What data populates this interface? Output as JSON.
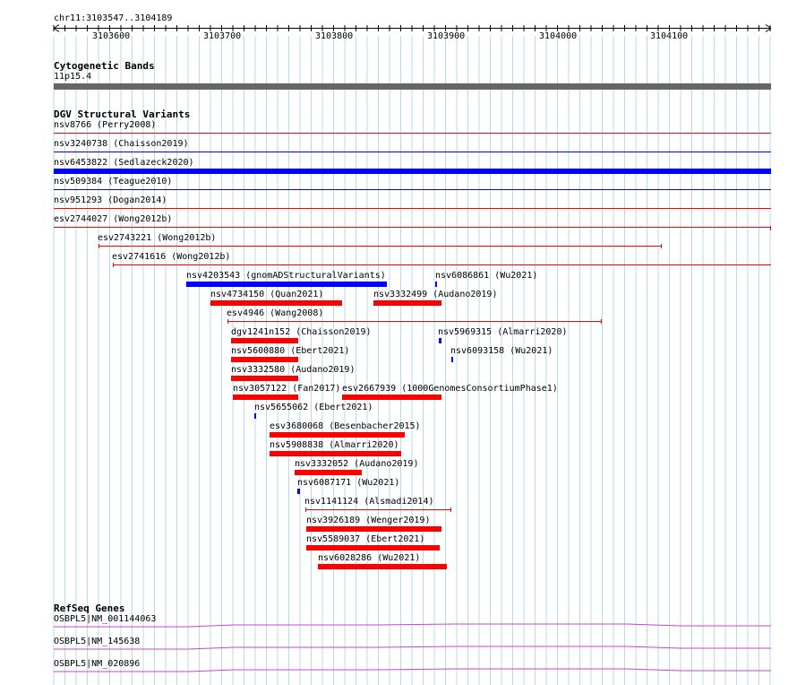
{
  "ruler": {
    "location": "chr11:3103547..3104189",
    "ticks": [
      "3103600",
      "3103700",
      "3103800",
      "3103900",
      "3104000",
      "3104100"
    ]
  },
  "cytoband": {
    "title": "Cytogenetic Bands",
    "band": "11p15.4"
  },
  "dgv": {
    "title": "DGV Structural Variants",
    "colors": {
      "loss": "#ff0000",
      "gain": "#0000ff"
    },
    "full_rows": [
      {
        "label": "nsv8766 (Perry2008)",
        "color": "#ff0000",
        "thick": false
      },
      {
        "label": "nsv3240738 (Chaisson2019)",
        "color": "#0000ff",
        "thick": false
      },
      {
        "label": "nsv6453822 (Sedlazeck2020)",
        "color": "#0000ff",
        "thick": true
      },
      {
        "label": "nsv509384 (Teague2010)",
        "color": "#0000ff",
        "thick": false
      },
      {
        "label": "nsv951293 (Dogan2014)",
        "color": "#ff0000",
        "thick": false
      },
      {
        "label": "esv2744027 (Wong2012b)",
        "color": "#ff0000",
        "thick": false
      }
    ],
    "features": [
      {
        "label": "esv2743221 (Wong2012b)",
        "type": "line",
        "color": "#ff0000"
      },
      {
        "label": "esv2741616 (Wong2012b)",
        "type": "line",
        "color": "#ff0000"
      },
      {
        "label": "nsv4203543 (gnomADStructuralVariants)",
        "type": "bar",
        "color": "#0000ff"
      },
      {
        "label": "nsv6086861 (Wu2021)",
        "type": "bar",
        "color": "#0000ff"
      },
      {
        "label": "nsv4734150 (Quan2021)",
        "type": "bar",
        "color": "#ff0000"
      },
      {
        "label": "nsv3332499 (Audano2019)",
        "type": "bar",
        "color": "#ff0000"
      },
      {
        "label": "esv4946 (Wang2008)",
        "type": "line",
        "color": "#ff0000"
      },
      {
        "label": "dgv1241n152 (Chaisson2019)",
        "type": "bar",
        "color": "#ff0000"
      },
      {
        "label": "nsv5969315 (Almarri2020)",
        "type": "bar",
        "color": "#0000ff"
      },
      {
        "label": "nsv5600880 (Ebert2021)",
        "type": "bar",
        "color": "#ff0000"
      },
      {
        "label": "nsv6093158 (Wu2021)",
        "type": "bar",
        "color": "#0000ff"
      },
      {
        "label": "nsv3332580 (Audano2019)",
        "type": "bar",
        "color": "#ff0000"
      },
      {
        "label": "nsv3057122 (Fan2017)",
        "type": "bar",
        "color": "#ff0000"
      },
      {
        "label": "esv2667939 (1000GenomesConsortiumPhase1)",
        "type": "bar",
        "color": "#ff0000"
      },
      {
        "label": "nsv5655062 (Ebert2021)",
        "type": "bar",
        "color": "#0000ff"
      },
      {
        "label": "esv3680068 (Besenbacher2015)",
        "type": "bar",
        "color": "#ff0000"
      },
      {
        "label": "nsv5908838 (Almarri2020)",
        "type": "bar",
        "color": "#ff0000"
      },
      {
        "label": "nsv3332052 (Audano2019)",
        "type": "bar",
        "color": "#ff0000"
      },
      {
        "label": "nsv6087171 (Wu2021)",
        "type": "bar",
        "color": "#0000ff"
      },
      {
        "label": "nsv1141124 (Alsmadi2014)",
        "type": "line",
        "color": "#ff0000"
      },
      {
        "label": "nsv3926189 (Wenger2019)",
        "type": "bar",
        "color": "#ff0000"
      },
      {
        "label": "nsv5589037 (Ebert2021)",
        "type": "bar",
        "color": "#ff0000"
      },
      {
        "label": "nsv6028286 (Wu2021)",
        "type": "bar",
        "color": "#ff0000"
      }
    ]
  },
  "refseq": {
    "title": "RefSeq Genes",
    "color": "#cc44cc",
    "genes": [
      "OSBPL5|NM_001144063",
      "OSBPL5|NM_145638",
      "OSBPL5|NM_020896"
    ]
  }
}
